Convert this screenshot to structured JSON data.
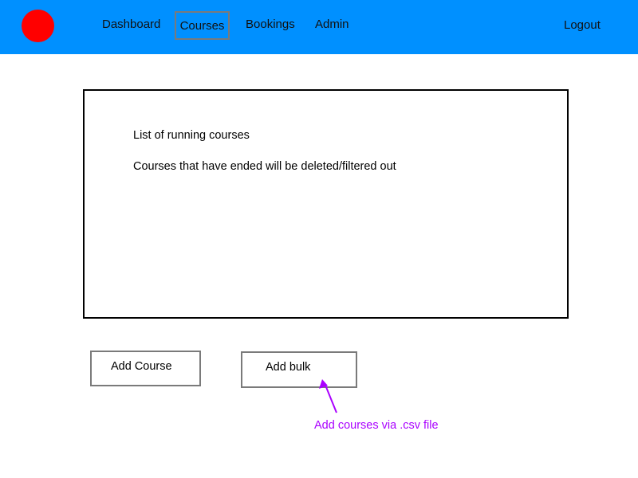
{
  "nav": {
    "items": [
      {
        "label": "Dashboard"
      },
      {
        "label": "Courses",
        "active": true
      },
      {
        "label": "Bookings"
      },
      {
        "label": "Admin"
      }
    ],
    "logout_label": "Logout"
  },
  "panel": {
    "line1": "List of running courses",
    "line2": "Courses that have ended will be deleted/filtered out"
  },
  "actions": {
    "add_course_label": "Add Course",
    "add_bulk_label": "Add bulk"
  },
  "annotation": {
    "text": "Add courses via .csv file"
  },
  "colors": {
    "header": "#0090ff",
    "logo": "#ff0000",
    "annotation": "#aa00ff"
  },
  "icons": {
    "logo": "red-circle-logo",
    "annotation_arrow": "arrow-up-left-icon"
  }
}
